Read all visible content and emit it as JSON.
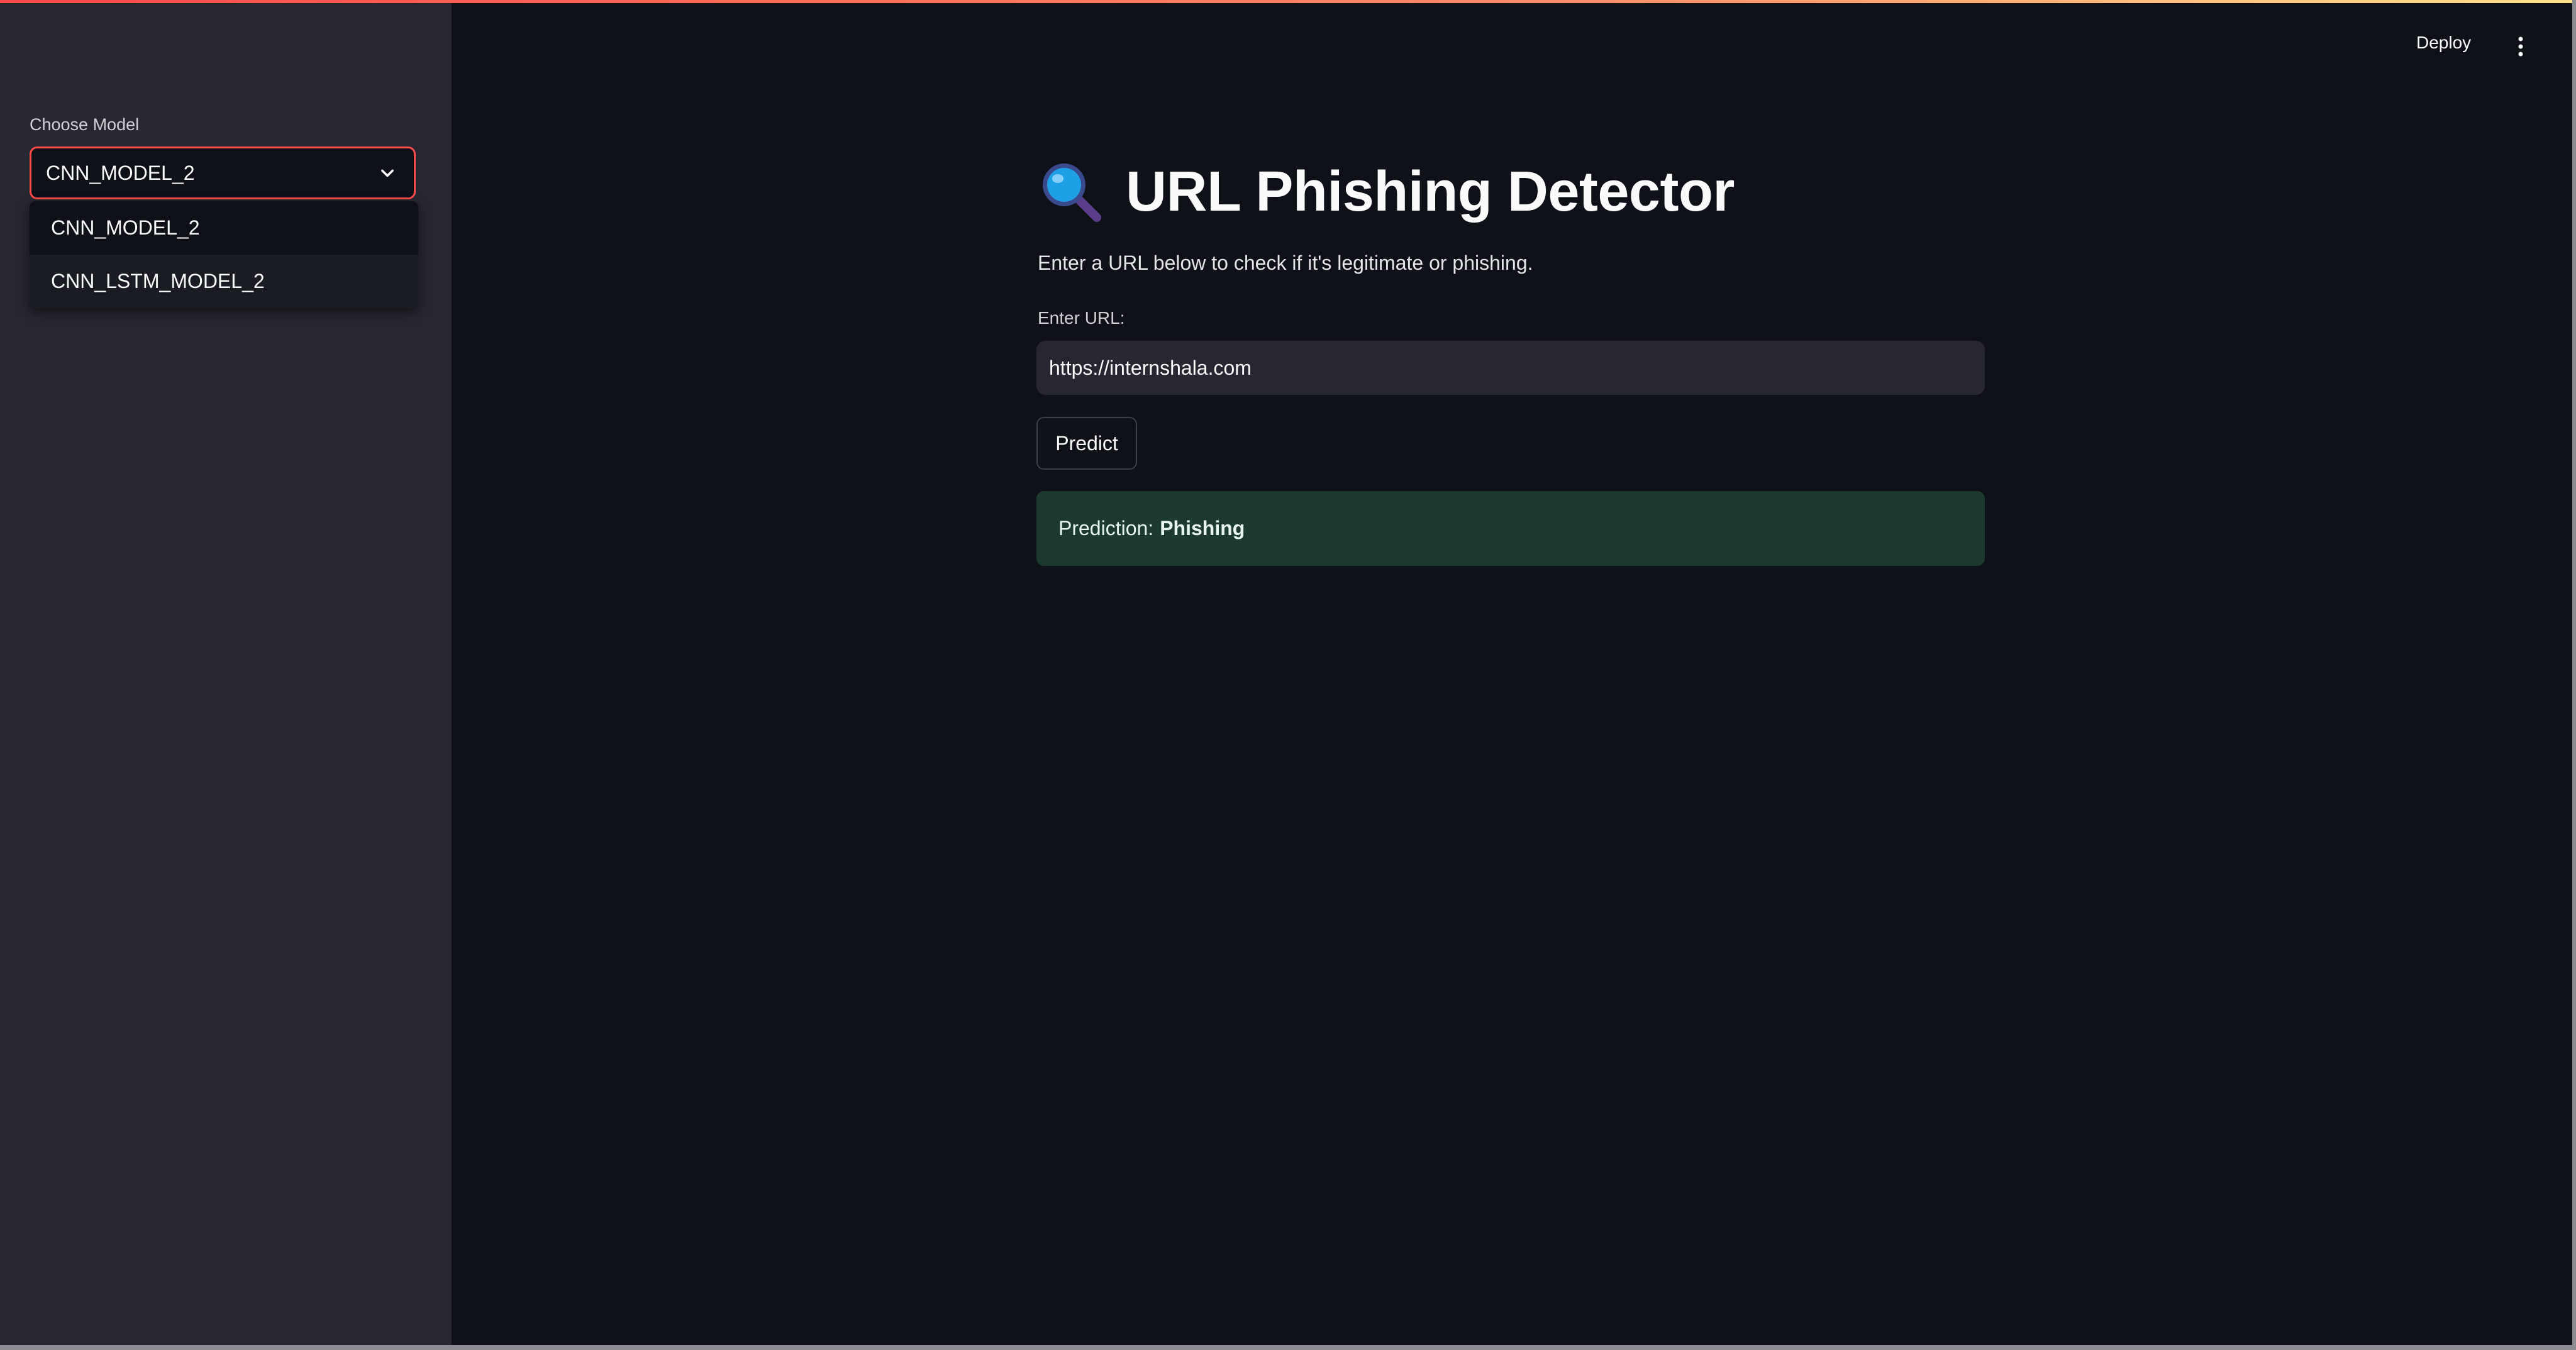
{
  "header": {
    "deploy_label": "Deploy",
    "menu_icon": "more-vertical-icon"
  },
  "sidebar": {
    "model_label": "Choose Model",
    "selected_model": "CNN_MODEL_2",
    "options": [
      "CNN_MODEL_2",
      "CNN_LSTM_MODEL_2"
    ]
  },
  "main": {
    "title_icon": "magnifying-glass-icon",
    "title": "URL Phishing Detector",
    "description": "Enter a URL below to check if it's legitimate or phishing.",
    "url_label": "Enter URL:",
    "url_value": "https://internshala.com",
    "predict_label": "Predict",
    "result": {
      "label": "Prediction:",
      "value": "Phishing"
    }
  },
  "colors": {
    "background": "#0e1117",
    "sidebar": "#262730",
    "accent": "#ff4b4b",
    "success_box": "#1c3a2d"
  }
}
